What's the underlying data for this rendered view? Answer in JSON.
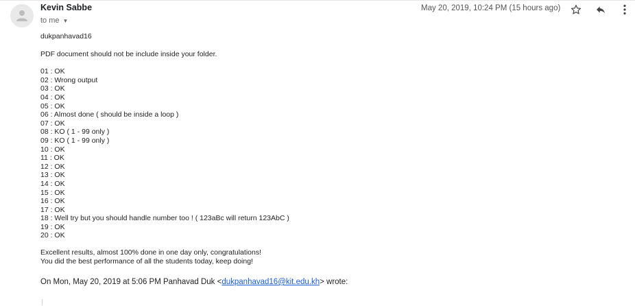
{
  "header": {
    "sender_name": "Kevin Sabbe",
    "recipient_label": "to me",
    "date": "May 20, 2019, 10:24 PM (15 hours ago)",
    "icons": {
      "avatar": "person-icon",
      "star": "star-icon",
      "reply": "reply-icon",
      "more": "more-vertical-icon",
      "caret": "chevron-down-icon"
    }
  },
  "body": {
    "greeting": "dukpanhavad16",
    "intro": "PDF document should not be include inside your folder.",
    "results": [
      "01 : OK",
      "02 : Wrong output",
      "03 : OK",
      "04 : OK",
      "05 : OK",
      "06 : Almost done ( should be inside a loop )",
      "07 : OK",
      "08 : KO ( 1 - 99 only )",
      "09 : KO ( 1 - 99 only )",
      "10 : OK",
      "11 : OK",
      "12 : OK",
      "13 : OK",
      "14 : OK",
      "15 : OK",
      "16 : OK",
      "17 : OK",
      "18 : Well try but you should handle number too ! ( 123aBc will return 123AbC )",
      "19 : OK",
      "20 : OK"
    ],
    "closing_1": "Excellent results, almost 100% done in one day only, congratulations!",
    "closing_2": "You did the best performance of all the students today, keep doing!"
  },
  "quote": {
    "prefix": "On Mon, May 20, 2019 at 5:06 PM Panhavad Duk <",
    "email": "dukpanhavad16@kit.edu.kh",
    "suffix": "> wrote:"
  },
  "colors": {
    "link": "#1a5cd4",
    "text": "#222222",
    "muted": "#666666"
  }
}
